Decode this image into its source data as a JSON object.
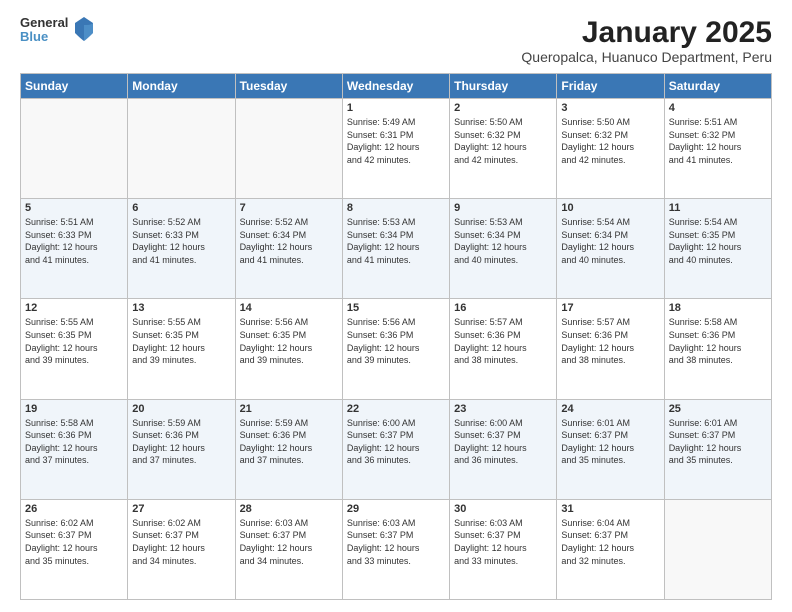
{
  "logo": {
    "general": "General",
    "blue": "Blue"
  },
  "title": "January 2025",
  "subtitle": "Queropalca, Huanuco Department, Peru",
  "days_of_week": [
    "Sunday",
    "Monday",
    "Tuesday",
    "Wednesday",
    "Thursday",
    "Friday",
    "Saturday"
  ],
  "weeks": [
    [
      {
        "day": "",
        "info": ""
      },
      {
        "day": "",
        "info": ""
      },
      {
        "day": "",
        "info": ""
      },
      {
        "day": "1",
        "info": "Sunrise: 5:49 AM\nSunset: 6:31 PM\nDaylight: 12 hours\nand 42 minutes."
      },
      {
        "day": "2",
        "info": "Sunrise: 5:50 AM\nSunset: 6:32 PM\nDaylight: 12 hours\nand 42 minutes."
      },
      {
        "day": "3",
        "info": "Sunrise: 5:50 AM\nSunset: 6:32 PM\nDaylight: 12 hours\nand 42 minutes."
      },
      {
        "day": "4",
        "info": "Sunrise: 5:51 AM\nSunset: 6:32 PM\nDaylight: 12 hours\nand 41 minutes."
      }
    ],
    [
      {
        "day": "5",
        "info": "Sunrise: 5:51 AM\nSunset: 6:33 PM\nDaylight: 12 hours\nand 41 minutes."
      },
      {
        "day": "6",
        "info": "Sunrise: 5:52 AM\nSunset: 6:33 PM\nDaylight: 12 hours\nand 41 minutes."
      },
      {
        "day": "7",
        "info": "Sunrise: 5:52 AM\nSunset: 6:34 PM\nDaylight: 12 hours\nand 41 minutes."
      },
      {
        "day": "8",
        "info": "Sunrise: 5:53 AM\nSunset: 6:34 PM\nDaylight: 12 hours\nand 41 minutes."
      },
      {
        "day": "9",
        "info": "Sunrise: 5:53 AM\nSunset: 6:34 PM\nDaylight: 12 hours\nand 40 minutes."
      },
      {
        "day": "10",
        "info": "Sunrise: 5:54 AM\nSunset: 6:34 PM\nDaylight: 12 hours\nand 40 minutes."
      },
      {
        "day": "11",
        "info": "Sunrise: 5:54 AM\nSunset: 6:35 PM\nDaylight: 12 hours\nand 40 minutes."
      }
    ],
    [
      {
        "day": "12",
        "info": "Sunrise: 5:55 AM\nSunset: 6:35 PM\nDaylight: 12 hours\nand 39 minutes."
      },
      {
        "day": "13",
        "info": "Sunrise: 5:55 AM\nSunset: 6:35 PM\nDaylight: 12 hours\nand 39 minutes."
      },
      {
        "day": "14",
        "info": "Sunrise: 5:56 AM\nSunset: 6:35 PM\nDaylight: 12 hours\nand 39 minutes."
      },
      {
        "day": "15",
        "info": "Sunrise: 5:56 AM\nSunset: 6:36 PM\nDaylight: 12 hours\nand 39 minutes."
      },
      {
        "day": "16",
        "info": "Sunrise: 5:57 AM\nSunset: 6:36 PM\nDaylight: 12 hours\nand 38 minutes."
      },
      {
        "day": "17",
        "info": "Sunrise: 5:57 AM\nSunset: 6:36 PM\nDaylight: 12 hours\nand 38 minutes."
      },
      {
        "day": "18",
        "info": "Sunrise: 5:58 AM\nSunset: 6:36 PM\nDaylight: 12 hours\nand 38 minutes."
      }
    ],
    [
      {
        "day": "19",
        "info": "Sunrise: 5:58 AM\nSunset: 6:36 PM\nDaylight: 12 hours\nand 37 minutes."
      },
      {
        "day": "20",
        "info": "Sunrise: 5:59 AM\nSunset: 6:36 PM\nDaylight: 12 hours\nand 37 minutes."
      },
      {
        "day": "21",
        "info": "Sunrise: 5:59 AM\nSunset: 6:36 PM\nDaylight: 12 hours\nand 37 minutes."
      },
      {
        "day": "22",
        "info": "Sunrise: 6:00 AM\nSunset: 6:37 PM\nDaylight: 12 hours\nand 36 minutes."
      },
      {
        "day": "23",
        "info": "Sunrise: 6:00 AM\nSunset: 6:37 PM\nDaylight: 12 hours\nand 36 minutes."
      },
      {
        "day": "24",
        "info": "Sunrise: 6:01 AM\nSunset: 6:37 PM\nDaylight: 12 hours\nand 35 minutes."
      },
      {
        "day": "25",
        "info": "Sunrise: 6:01 AM\nSunset: 6:37 PM\nDaylight: 12 hours\nand 35 minutes."
      }
    ],
    [
      {
        "day": "26",
        "info": "Sunrise: 6:02 AM\nSunset: 6:37 PM\nDaylight: 12 hours\nand 35 minutes."
      },
      {
        "day": "27",
        "info": "Sunrise: 6:02 AM\nSunset: 6:37 PM\nDaylight: 12 hours\nand 34 minutes."
      },
      {
        "day": "28",
        "info": "Sunrise: 6:03 AM\nSunset: 6:37 PM\nDaylight: 12 hours\nand 34 minutes."
      },
      {
        "day": "29",
        "info": "Sunrise: 6:03 AM\nSunset: 6:37 PM\nDaylight: 12 hours\nand 33 minutes."
      },
      {
        "day": "30",
        "info": "Sunrise: 6:03 AM\nSunset: 6:37 PM\nDaylight: 12 hours\nand 33 minutes."
      },
      {
        "day": "31",
        "info": "Sunrise: 6:04 AM\nSunset: 6:37 PM\nDaylight: 12 hours\nand 32 minutes."
      },
      {
        "day": "",
        "info": ""
      }
    ]
  ]
}
